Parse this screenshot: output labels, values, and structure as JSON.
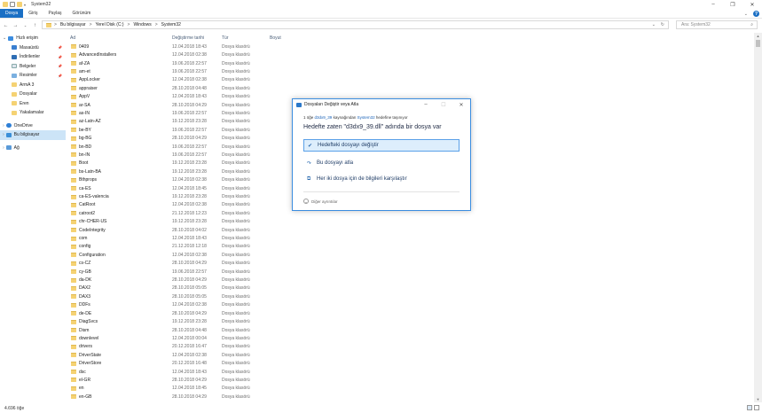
{
  "window": {
    "title": "System32"
  },
  "ribbon": {
    "tabs": [
      "Dosya",
      "Giriş",
      "Paylaş",
      "Görünüm"
    ]
  },
  "address": {
    "crumbs": [
      "Bu bilgisayar",
      "Yerel Disk (C:)",
      "Windows",
      "System32"
    ],
    "separator": ">"
  },
  "search": {
    "placeholder": "Ara: System32"
  },
  "navpane": {
    "quick_access": "Hızlı erişim",
    "items": [
      "Masaüstü",
      "İndirilenler",
      "Belgeler",
      "Resimler",
      "ArmA 3",
      "Dosyalar",
      "Eren",
      "Yakalamalar"
    ],
    "onedrive": "OneDrive",
    "this_pc": "Bu bilgisayar",
    "network": "Ağ"
  },
  "columns": {
    "name": "Ad",
    "date": "Değiştirme tarihi",
    "type": "Tür",
    "size": "Boyut"
  },
  "files": [
    {
      "name": "0409",
      "date": "12.04.2018 18:43",
      "type": "Dosya klasörü"
    },
    {
      "name": "AdvancedInstallers",
      "date": "12.04.2018 02:38",
      "type": "Dosya klasörü"
    },
    {
      "name": "af-ZA",
      "date": "19.06.2018 22:57",
      "type": "Dosya klasörü"
    },
    {
      "name": "am-et",
      "date": "19.06.2018 22:57",
      "type": "Dosya klasörü"
    },
    {
      "name": "AppLocker",
      "date": "12.04.2018 02:38",
      "type": "Dosya klasörü"
    },
    {
      "name": "appraiser",
      "date": "28.10.2018 04:48",
      "type": "Dosya klasörü"
    },
    {
      "name": "AppV",
      "date": "12.04.2018 18:43",
      "type": "Dosya klasörü"
    },
    {
      "name": "ar-SA",
      "date": "28.10.2018 04:29",
      "type": "Dosya klasörü"
    },
    {
      "name": "as-IN",
      "date": "19.06.2018 22:57",
      "type": "Dosya klasörü"
    },
    {
      "name": "az-Latn-AZ",
      "date": "19.12.2018 23:28",
      "type": "Dosya klasörü"
    },
    {
      "name": "be-BY",
      "date": "19.06.2018 22:57",
      "type": "Dosya klasörü"
    },
    {
      "name": "bg-BG",
      "date": "28.10.2018 04:29",
      "type": "Dosya klasörü"
    },
    {
      "name": "bn-BD",
      "date": "19.06.2018 22:57",
      "type": "Dosya klasörü"
    },
    {
      "name": "bn-IN",
      "date": "19.06.2018 22:57",
      "type": "Dosya klasörü"
    },
    {
      "name": "Boot",
      "date": "19.12.2018 23:28",
      "type": "Dosya klasörü"
    },
    {
      "name": "bs-Latn-BA",
      "date": "19.12.2018 23:28",
      "type": "Dosya klasörü"
    },
    {
      "name": "Bthprops",
      "date": "12.04.2018 02:38",
      "type": "Dosya klasörü"
    },
    {
      "name": "ca-ES",
      "date": "12.04.2018 18:45",
      "type": "Dosya klasörü"
    },
    {
      "name": "ca-ES-valencia",
      "date": "19.12.2018 23:28",
      "type": "Dosya klasörü"
    },
    {
      "name": "CatRoot",
      "date": "12.04.2018 02:38",
      "type": "Dosya klasörü"
    },
    {
      "name": "catroot2",
      "date": "21.12.2018 12:23",
      "type": "Dosya klasörü"
    },
    {
      "name": "chr-CHER-US",
      "date": "19.12.2018 23:28",
      "type": "Dosya klasörü"
    },
    {
      "name": "CodeIntegrity",
      "date": "28.10.2018 04:02",
      "type": "Dosya klasörü"
    },
    {
      "name": "com",
      "date": "12.04.2018 18:43",
      "type": "Dosya klasörü"
    },
    {
      "name": "config",
      "date": "21.12.2018 12:18",
      "type": "Dosya klasörü"
    },
    {
      "name": "Configuration",
      "date": "12.04.2018 02:38",
      "type": "Dosya klasörü"
    },
    {
      "name": "cs-CZ",
      "date": "28.10.2018 04:29",
      "type": "Dosya klasörü"
    },
    {
      "name": "cy-GB",
      "date": "19.06.2018 22:57",
      "type": "Dosya klasörü"
    },
    {
      "name": "da-DK",
      "date": "28.10.2018 04:29",
      "type": "Dosya klasörü"
    },
    {
      "name": "DAX2",
      "date": "28.10.2018 05:05",
      "type": "Dosya klasörü"
    },
    {
      "name": "DAX3",
      "date": "28.10.2018 05:05",
      "type": "Dosya klasörü"
    },
    {
      "name": "DDFs",
      "date": "12.04.2018 02:38",
      "type": "Dosya klasörü"
    },
    {
      "name": "de-DE",
      "date": "28.10.2018 04:29",
      "type": "Dosya klasörü"
    },
    {
      "name": "DiagSvcs",
      "date": "19.12.2018 23:28",
      "type": "Dosya klasörü"
    },
    {
      "name": "Dism",
      "date": "28.10.2018 04:48",
      "type": "Dosya klasörü"
    },
    {
      "name": "downlevel",
      "date": "12.04.2018 00:04",
      "type": "Dosya klasörü"
    },
    {
      "name": "drivers",
      "date": "20.12.2018 16:47",
      "type": "Dosya klasörü"
    },
    {
      "name": "DriverState",
      "date": "12.04.2018 02:38",
      "type": "Dosya klasörü"
    },
    {
      "name": "DriverStore",
      "date": "20.12.2018 16:48",
      "type": "Dosya klasörü"
    },
    {
      "name": "dsc",
      "date": "12.04.2018 18:43",
      "type": "Dosya klasörü"
    },
    {
      "name": "el-GR",
      "date": "28.10.2018 04:29",
      "type": "Dosya klasörü"
    },
    {
      "name": "en",
      "date": "12.04.2018 18:45",
      "type": "Dosya klasörü"
    },
    {
      "name": "en-GB",
      "date": "28.10.2018 04:29",
      "type": "Dosya klasörü"
    }
  ],
  "status": {
    "count": "4.696 öğe"
  },
  "dialog": {
    "title": "Dosyaları Değiştir veya Atla",
    "sub_prefix": "1 öğe",
    "sub_file": "d3dx9_39",
    "sub_mid": "kaynağından",
    "sub_dest": "System32",
    "sub_suffix": "hedefine taşınıyor",
    "heading": "Hedefte zaten \"d3dx9_39.dll\" adında bir dosya var",
    "opt_replace": "Hedefteki dosyayı değiştir",
    "opt_skip": "Bu dosyayı atla",
    "opt_compare": "Her iki dosya için de bilgileri karşılaştır",
    "details": "Diğer ayrıntılar"
  },
  "colors": {
    "accent": "#1a6fc4",
    "selection": "#cce4f7",
    "folder": "#f5d273"
  }
}
